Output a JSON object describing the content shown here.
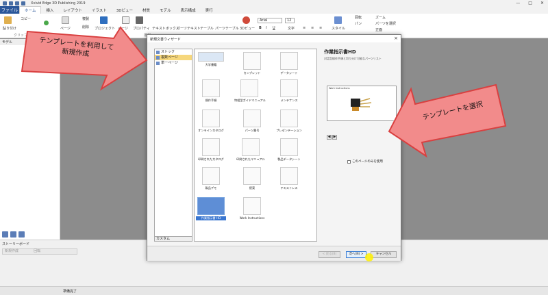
{
  "app": {
    "title": "Xvivid Edge 3D Publishing 2019"
  },
  "ribbon_tabs": {
    "file": "ファイル",
    "items": [
      "ホーム",
      "挿入",
      "レイアウト",
      "イラスト",
      "3Dビュー",
      "材質",
      "モデル",
      "表示構成",
      "実行"
    ]
  },
  "ribbon": {
    "copy": "コピー",
    "paste": "貼り付け",
    "cut": "",
    "page": "ページ",
    "duplicate": "複製",
    "delete": "削除",
    "project": "プロジェクト",
    "pages": "ページ",
    "properties": "プロパティ",
    "textbox": "テキストボックス",
    "parts_text": "パーツテキスト",
    "table": "テーブル",
    "parts_table": "パーツテーブル",
    "view3d": "3Dビュー",
    "font": "Arial",
    "font_size": "12",
    "text_label": "文字",
    "style": "スタイル",
    "rotate": "回転",
    "pan": "パン",
    "zoom": "ズーム",
    "select_parts": "パーツを選択",
    "front": "正面",
    "clipboard": "クリップ",
    "select": "選択"
  },
  "left_panel": {
    "header": "モデル"
  },
  "storyboard": {
    "title": "ストーリーボード",
    "tool_new": "新規作成",
    "tool_rotate": "回転"
  },
  "status": {
    "text": "準備完了"
  },
  "dialog": {
    "title": "新規文書ウィザード",
    "close": "×",
    "categories": [
      {
        "label": "ストック",
        "selected": false
      },
      {
        "label": "複数ページ",
        "selected": true
      },
      {
        "label": "単一ページ",
        "selected": false
      }
    ],
    "custom_label": "カスタム",
    "templates": [
      {
        "label": "大学書籍"
      },
      {
        "label": "カンプレット"
      },
      {
        "label": "データシート"
      },
      {
        "label": "操作手順"
      },
      {
        "label": "特組型ガイドマニュアル"
      },
      {
        "label": "メンテナンス"
      },
      {
        "label": "オンラインカタログ"
      },
      {
        "label": "パーツ番号"
      },
      {
        "label": "プレゼンテーション"
      },
      {
        "label": "印刷されたカタログ"
      },
      {
        "label": "印刷されたマニュアル"
      },
      {
        "label": "製品データシート"
      },
      {
        "label": "製品デモ"
      },
      {
        "label": "提案"
      },
      {
        "label": "テキストレス"
      },
      {
        "label": "作業指示書 HD",
        "selected": true
      },
      {
        "label": "Work Instructions"
      }
    ],
    "preview": {
      "title": "作業指示書HD",
      "subtitle": "対話型操作手順と切り分け可能なパーツリスト",
      "image_label": "Work Instructions",
      "prev_arrow": "◀",
      "next_arrow": "▶",
      "checkbox_label": "このページのみを使用"
    },
    "buttons": {
      "back": "< 戻る(B)",
      "next": "次へ(N) >",
      "cancel": "キャンセル"
    }
  },
  "callouts": {
    "left": "テンプレートを利用して\n新規作成",
    "right": "テンプレートを選択"
  },
  "colors": {
    "accent": "#2b579a",
    "callout_fill": "#f28b8b",
    "callout_stroke": "#d94040",
    "selected_category": "#f6d77c",
    "selected_thumb": "#3a76d0"
  }
}
